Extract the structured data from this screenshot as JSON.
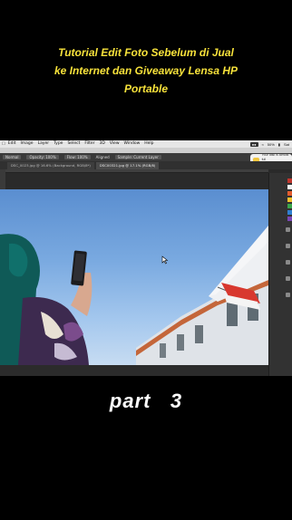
{
  "caption": {
    "title": "Tutorial Edit Foto Sebelum di Jual\nke Internet dan Giveaway Lensa HP\nPortable",
    "part_text": "part   3"
  },
  "menubar": {
    "items": [
      "Edit",
      "Image",
      "Layer",
      "Type",
      "Select",
      "Filter",
      "3D",
      "View",
      "Window",
      "Help"
    ],
    "status_right": [
      "50%",
      "Sat"
    ]
  },
  "app": {
    "window_title": "Adobe Photoshop CC 2017"
  },
  "options_bar": {
    "items": [
      "Normal",
      "Opacity: 100%",
      "Flow: 100%",
      "Aligned",
      "Sample: Current Layer"
    ]
  },
  "notification": {
    "text": "Your disk is almost full\nSave space by optimizing"
  },
  "tabs": [
    {
      "label": "DSC_0023.jpg @ 16.6% (Background, RGB/8*)",
      "active": false
    },
    {
      "label": "DSC00321.jpg @ 17.1% (RGB/8)",
      "active": true
    }
  ],
  "colors": {
    "title_yellow": "#f7e23b",
    "sky_blue": "#6aa0dc",
    "building_white": "#e9ecef",
    "roof_orange": "#c4663a",
    "flag_red": "#d8382f"
  },
  "icons": [
    "apple-icon",
    "wifi-icon",
    "battery-icon",
    "mouse-cursor-icon",
    "notification-app-icon"
  ]
}
